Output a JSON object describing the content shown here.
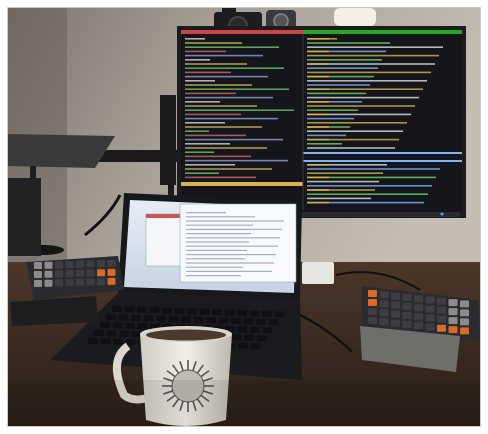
{
  "photo": {
    "subject": "desk-setup",
    "colors": {
      "wall": "#b8b1a8",
      "wall_shadow": "#6f6a64",
      "desk": "#3b2c22",
      "monitor_bezel": "#1b1c20",
      "terminal_bg": "#15161b",
      "laptop_body": "#17181c",
      "laptop_screen": "#d9e4f1",
      "mug": "#e9e6e0",
      "keyboard": "#2a2b2f",
      "keycap_orange": "#d86a2a",
      "keycap_gray": "#8c8c8c",
      "stand_gray": "#6e6e6a"
    },
    "icons": [
      "camera-icon",
      "webcam-icon",
      "lamp-icon",
      "sun-illustration-icon"
    ]
  }
}
